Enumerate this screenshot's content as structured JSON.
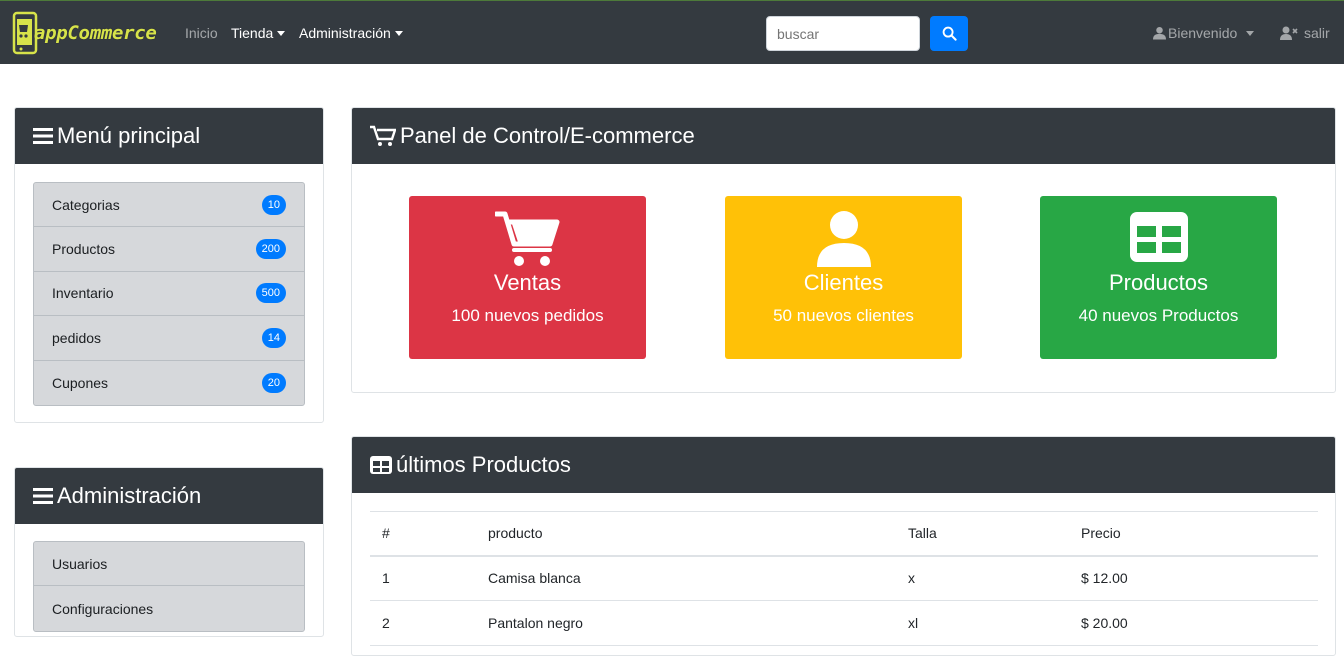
{
  "navbar": {
    "brand": "appCommerce",
    "links": {
      "inicio": "Inicio",
      "tienda": "Tienda",
      "administracion": "Administración"
    },
    "search": {
      "placeholder": "buscar"
    },
    "user": {
      "welcome": "Bienvenido",
      "logout": "salir"
    }
  },
  "sidebar": {
    "main_menu": {
      "title": "Menú principal",
      "items": [
        {
          "label": "Categorias",
          "count": "10"
        },
        {
          "label": "Productos",
          "count": "200"
        },
        {
          "label": "Inventario",
          "count": "500"
        },
        {
          "label": "pedidos",
          "count": "14"
        },
        {
          "label": "Cupones",
          "count": "20"
        }
      ]
    },
    "admin_menu": {
      "title": "Administración",
      "items": [
        {
          "label": "Usuarios"
        },
        {
          "label": "Configuraciones"
        }
      ]
    }
  },
  "dashboard": {
    "title": "Panel de Control/E-commerce",
    "tiles": [
      {
        "title": "Ventas",
        "subtitle": "100 nuevos pedidos",
        "color": "#dc3545",
        "icon": "cart-icon"
      },
      {
        "title": "Clientes",
        "subtitle": "50 nuevos clientes",
        "color": "#ffc107",
        "icon": "user-icon"
      },
      {
        "title": "Productos",
        "subtitle": "40 nuevos Productos",
        "color": "#28a745",
        "icon": "table-icon"
      }
    ]
  },
  "latest_products": {
    "title": "últimos Productos",
    "columns": [
      "#",
      "producto",
      "Talla",
      "Precio"
    ],
    "rows": [
      [
        "1",
        "Camisa blanca",
        "x",
        "$ 12.00"
      ],
      [
        "2",
        "Pantalon negro",
        "xl",
        "$ 20.00"
      ]
    ]
  },
  "colors": {
    "navbar": "#343a40",
    "primary": "#007bff",
    "brand": "#d7e34a"
  }
}
